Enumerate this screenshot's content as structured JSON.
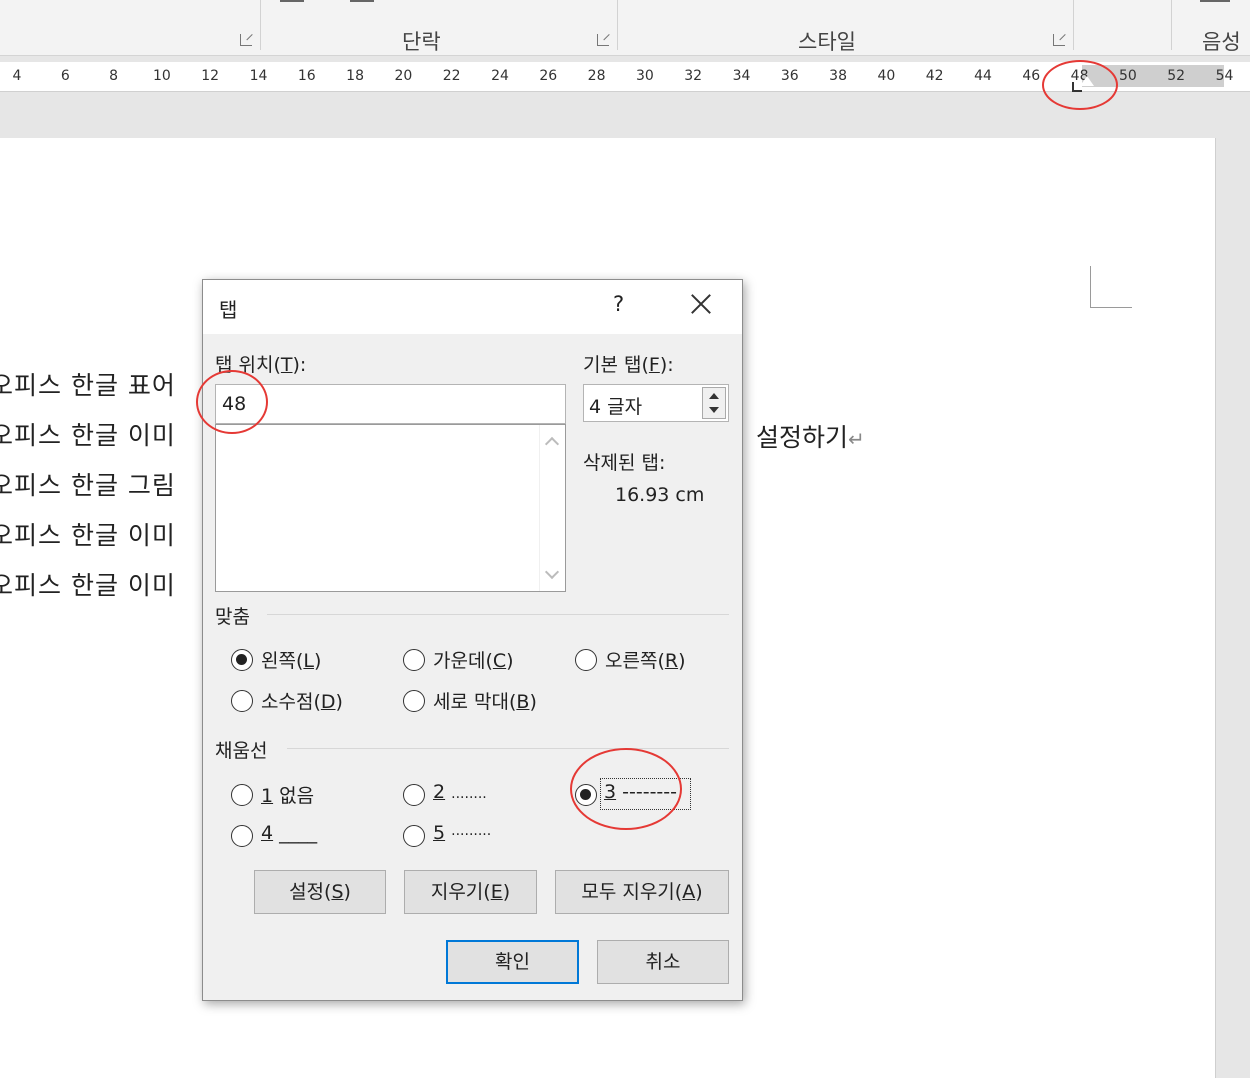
{
  "ribbon": {
    "groups": [
      "단락",
      "스타일",
      "음성"
    ]
  },
  "ruler": {
    "ticks": [
      "4",
      "6",
      "8",
      "10",
      "12",
      "14",
      "16",
      "18",
      "20",
      "22",
      "24",
      "26",
      "28",
      "30",
      "32",
      "34",
      "36",
      "38",
      "40",
      "42",
      "44",
      "46",
      "48",
      "50",
      "52",
      "54"
    ]
  },
  "document": {
    "lines": [
      "오피스 한글 표어",
      "오피스 한글 이미",
      "오피스 한글 그림",
      "오피스 한글 이미",
      "오피스 한글 이미"
    ],
    "tail_text": "설정하기",
    "para_mark": "↵"
  },
  "dialog": {
    "title": "탭",
    "help": "?",
    "tab_position": {
      "label": "탭 위치",
      "mnemonic": "T",
      "value": "48"
    },
    "default_tab": {
      "label": "기본 탭",
      "mnemonic": "F",
      "value": "4 글자"
    },
    "deleted_tabs": {
      "label": "삭제된 탭:",
      "value": "16.93 cm"
    },
    "alignment": {
      "label": "맞춤",
      "options": [
        {
          "text": "왼쪽",
          "mnemonic": "L",
          "checked": true
        },
        {
          "text": "가운데",
          "mnemonic": "C",
          "checked": false
        },
        {
          "text": "오른쪽",
          "mnemonic": "R",
          "checked": false
        },
        {
          "text": "소수점",
          "mnemonic": "D",
          "checked": false
        },
        {
          "text": "세로 막대",
          "mnemonic": "B",
          "checked": false
        }
      ]
    },
    "leader": {
      "label": "채움선",
      "options": [
        {
          "num": "1",
          "text": "없음",
          "checked": false
        },
        {
          "num": "2",
          "text": "........",
          "checked": false
        },
        {
          "num": "3",
          "text": "--------",
          "checked": true
        },
        {
          "num": "4",
          "text": "____",
          "checked": false
        },
        {
          "num": "5",
          "text": "·········",
          "checked": false
        }
      ]
    },
    "buttons": {
      "set": {
        "text": "설정",
        "mnemonic": "S"
      },
      "clear": {
        "text": "지우기",
        "mnemonic": "E"
      },
      "clear_all": {
        "text": "모두 지우기",
        "mnemonic": "A"
      },
      "ok": "확인",
      "cancel": "취소"
    }
  },
  "annotation_color": "#e53935"
}
